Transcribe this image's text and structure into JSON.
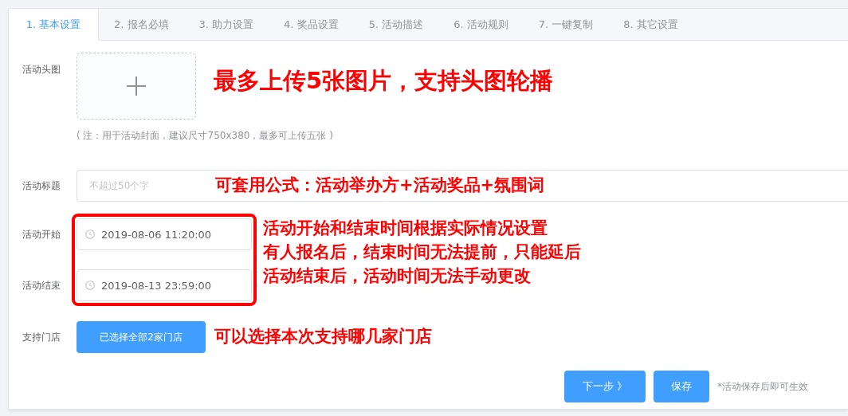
{
  "tabs": [
    {
      "label": "1. 基本设置",
      "selected": true
    },
    {
      "label": "2. 报名必填",
      "selected": false
    },
    {
      "label": "3. 助力设置",
      "selected": false
    },
    {
      "label": "4. 奖品设置",
      "selected": false
    },
    {
      "label": "5. 活动描述",
      "selected": false
    },
    {
      "label": "6. 活动规则",
      "selected": false
    },
    {
      "label": "7. 一键复制",
      "selected": false
    },
    {
      "label": "8. 其它设置",
      "selected": false
    }
  ],
  "header_image": {
    "label": "活动头图",
    "annotation": "最多上传5张图片，支持头图轮播",
    "note": "( 注：用于活动封面，建议尺寸750x380，最多可上传五张 )"
  },
  "title": {
    "label": "活动标题",
    "placeholder": "不超过50个字",
    "annotation": "可套用公式：活动举办方+活动奖品+氛围词"
  },
  "times": [
    {
      "label": "活动开始",
      "value": "2019-08-06 11:20:00"
    },
    {
      "label": "活动结束",
      "value": "2019-08-13 23:59:00"
    }
  ],
  "time_annotation": [
    "活动开始和结束时间根据实际情况设置",
    "有人报名后，结束时间无法提前，只能延后",
    "活动结束后，活动时间无法手动更改"
  ],
  "stores": {
    "label": "支持门店",
    "button": "已选择全部2家门店",
    "annotation": "可以选择本次支持哪几家门店"
  },
  "actions": {
    "next": "下一步 》",
    "save": "保存",
    "note": "*活动保存后即可生效"
  }
}
